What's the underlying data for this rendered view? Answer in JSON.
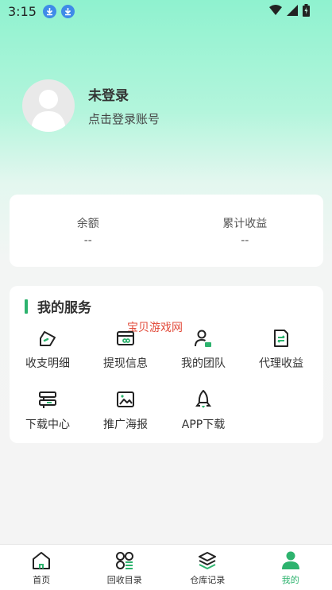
{
  "status": {
    "time": "3:15"
  },
  "profile": {
    "name": "未登录",
    "hint": "点击登录账号"
  },
  "balance": {
    "items": [
      {
        "label": "余额",
        "value": "--"
      },
      {
        "label": "累计收益",
        "value": "--"
      }
    ]
  },
  "services": {
    "title": "我的服务",
    "watermark": "宝贝游戏网",
    "items": [
      {
        "label": "收支明细",
        "icon": "pen-icon"
      },
      {
        "label": "提现信息",
        "icon": "wallet-icon"
      },
      {
        "label": "我的团队",
        "icon": "team-icon"
      },
      {
        "label": "代理收益",
        "icon": "document-icon"
      },
      {
        "label": "下载中心",
        "icon": "stack-icon"
      },
      {
        "label": "推广海报",
        "icon": "image-icon"
      },
      {
        "label": "APP下载",
        "icon": "rocket-icon"
      }
    ]
  },
  "tabbar": {
    "items": [
      {
        "label": "首页",
        "icon": "home-icon"
      },
      {
        "label": "回收目录",
        "icon": "grid-icon"
      },
      {
        "label": "仓库记录",
        "icon": "layers-icon"
      },
      {
        "label": "我的",
        "icon": "user-icon",
        "active": true
      }
    ]
  },
  "colors": {
    "accent": "#2db36e",
    "watermark": "#e24b3b"
  }
}
